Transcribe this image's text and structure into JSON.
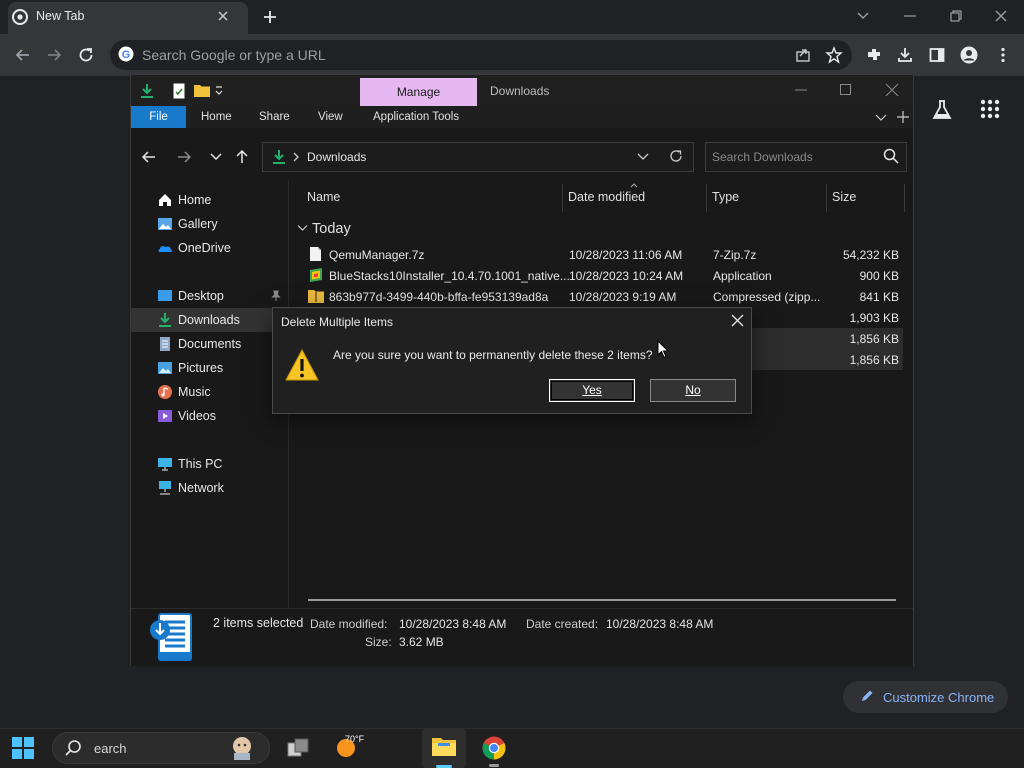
{
  "browser": {
    "tab_title": "New Tab",
    "omnibox_placeholder": "Search Google or type a URL",
    "customize_label": "Customize Chrome"
  },
  "explorer": {
    "title_manage": "Manage",
    "title_location": "Downloads",
    "ribbon": [
      "File",
      "Home",
      "Share",
      "View",
      "Application Tools"
    ],
    "address_path": "Downloads",
    "search_placeholder": "Search Downloads",
    "nav": {
      "home": "Home",
      "gallery": "Gallery",
      "onedrive": "OneDrive",
      "desktop": "Desktop",
      "downloads": "Downloads",
      "documents": "Documents",
      "pictures": "Pictures",
      "music": "Music",
      "videos": "Videos",
      "thispc": "This PC",
      "network": "Network"
    },
    "columns": {
      "name": "Name",
      "date": "Date modified",
      "type": "Type",
      "size": "Size"
    },
    "group": "Today",
    "files": [
      {
        "name": "QemuManager.7z",
        "date": "10/28/2023 11:06 AM",
        "type": "7-Zip.7z",
        "size": "54,232 KB"
      },
      {
        "name": "BlueStacks10Installer_10.4.70.1001_native...",
        "date": "10/28/2023 10:24 AM",
        "type": "Application",
        "size": "900 KB"
      },
      {
        "name": "863b977d-3499-440b-bffa-fe953139ad8a",
        "date": "10/28/2023 9:19 AM",
        "type": "Compressed (zipp...",
        "size": "841 KB"
      },
      {
        "name": "",
        "date": "",
        "type": "",
        "size": "1,903 KB"
      },
      {
        "name": "",
        "date": "",
        "type": "ation",
        "size": "1,856 KB"
      },
      {
        "name": "",
        "date": "",
        "type": "ation",
        "size": "1,856 KB"
      }
    ],
    "status": {
      "selected": "2 items selected",
      "date_modified_label": "Date modified:",
      "date_modified": "10/28/2023 8:48 AM",
      "date_created_label": "Date created:",
      "date_created": "10/28/2023 8:48 AM",
      "size_label": "Size:",
      "size": "3.62 MB"
    }
  },
  "dialog": {
    "title": "Delete Multiple Items",
    "message": "Are you sure you want to permanently delete these 2 items?",
    "yes": "Yes",
    "no": "No"
  },
  "taskbar": {
    "search_text": "earch",
    "weather_temp": "70°F"
  },
  "colors": {
    "accent_manage": "#e6b8f2",
    "file_tab": "#1979ca",
    "warning": "#f7c325",
    "chrome_link": "#8ab4f8"
  }
}
